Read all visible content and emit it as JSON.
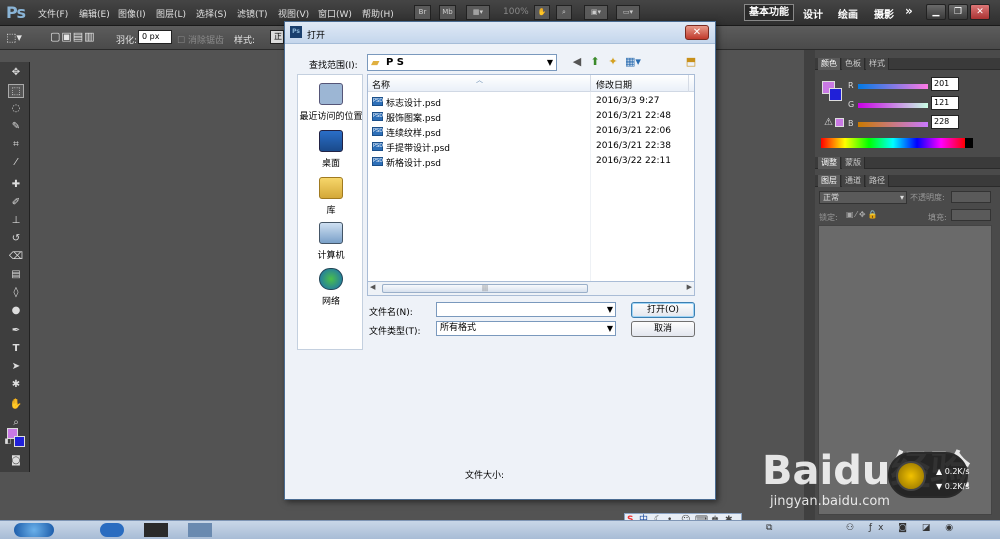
{
  "app": {
    "logo": "Ps",
    "menu": [
      "文件(F)",
      "编辑(E)",
      "图像(I)",
      "图层(L)",
      "选择(S)",
      "滤镜(T)",
      "视图(V)",
      "窗口(W)",
      "帮助(H)"
    ],
    "mini_buttons": [
      "Br",
      "Mb"
    ],
    "zoom": "100%",
    "workspaces": [
      "基本功能",
      "设计",
      "绘画",
      "摄影"
    ],
    "more": "»"
  },
  "options": {
    "feather_label": "羽化:",
    "feather_value": "0 px",
    "antialias_label": "消除锯齿",
    "style_label": "样式:",
    "style_value": "正"
  },
  "panels": {
    "color_tabs": [
      "颜色",
      "色板",
      "样式"
    ],
    "channels": [
      {
        "label": "R",
        "value": "201",
        "color": "#c979e4"
      },
      {
        "label": "G",
        "value": "121",
        "color": "#c979e4"
      },
      {
        "label": "B",
        "value": "228",
        "color": "#c979e4"
      }
    ],
    "adjust_tabs": [
      "调整",
      "蒙版"
    ],
    "layer_tabs": [
      "图层",
      "通道",
      "路径"
    ],
    "blend_mode": "正常",
    "opacity_label": "不透明度:",
    "lock_label": "锁定:",
    "fill_label": "填充:"
  },
  "foreground_color": "#c979e4",
  "background_color": "#2020d8",
  "dialog": {
    "title": "打开",
    "lookin_label": "查找范围(I):",
    "lookin_value": "P S",
    "places": [
      "最近访问的位置",
      "桌面",
      "库",
      "计算机",
      "网络"
    ],
    "columns": [
      "名称",
      "修改日期"
    ],
    "files": [
      {
        "name": "标志设计.psd",
        "date": "2016/3/3 9:27"
      },
      {
        "name": "服饰图案.psd",
        "date": "2016/3/21 22:48"
      },
      {
        "name": "连续纹样.psd",
        "date": "2016/3/21 22:06"
      },
      {
        "name": "手提带设计.psd",
        "date": "2016/3/21 22:38"
      },
      {
        "name": "新格设计.psd",
        "date": "2016/3/22 22:11"
      }
    ],
    "filename_label": "文件名(N):",
    "filename_value": "",
    "filetype_label": "文件类型(T):",
    "filetype_value": "所有格式",
    "open_button": "打开(O)",
    "cancel_button": "取消",
    "filesize_label": "文件大小:"
  },
  "ime": {
    "items": [
      "中"
    ]
  },
  "network": {
    "up": "0.2K/s",
    "down": "0.2K/s"
  },
  "watermark": {
    "text": "Baidu经验",
    "url": "jingyan.baidu.com"
  }
}
